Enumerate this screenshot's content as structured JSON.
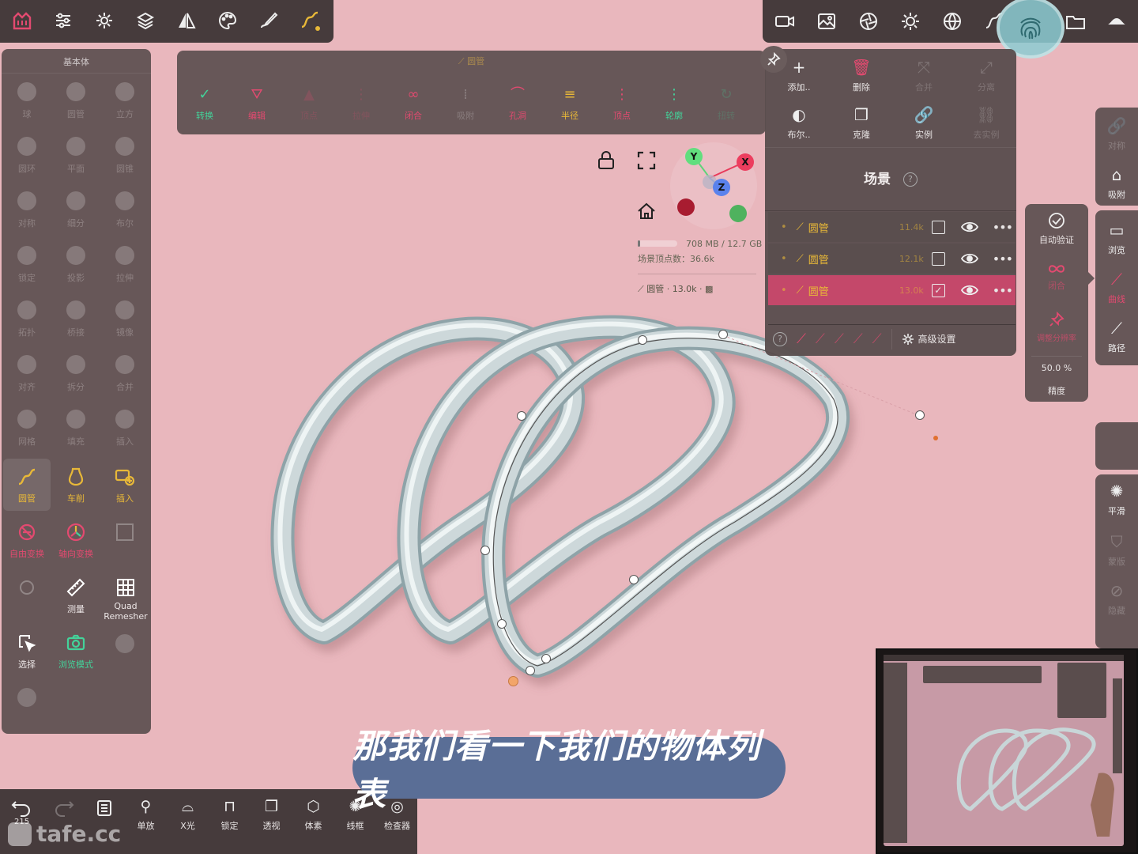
{
  "top_left_toolbar": {
    "icons": [
      "app-logo-icon",
      "sliders-icon",
      "settings-icon",
      "layers-icon",
      "symmetry-icon",
      "palette-icon",
      "brush-icon",
      "curve-icon"
    ]
  },
  "primitives_panel": {
    "title": "基本体",
    "dim_labels": [
      "球",
      "圆管",
      "立方",
      "圆环",
      "平面",
      "圆锥",
      "对称",
      "细分",
      "布尔",
      "锁定",
      "投影",
      "拉伸",
      "拓扑",
      "桥接",
      "镜像",
      "对齐",
      "拆分",
      "合并",
      "网格",
      "填充",
      "插入"
    ],
    "tools": [
      {
        "label": "圆管",
        "color": "#e8b838"
      },
      {
        "label": "车削",
        "color": "#e8b838"
      },
      {
        "label": "插入",
        "color": "#e8b838"
      },
      {
        "label": "自由变换",
        "color": "#e34a70"
      },
      {
        "label": "轴向变换",
        "color": "#e34a70"
      },
      {
        "label": "测量",
        "color": "#ffffff"
      },
      {
        "label": "Quad Remesher",
        "color": "#ffffff"
      },
      {
        "label": "选择",
        "color": "#ffffff"
      },
      {
        "label": "浏览模式",
        "color": "#43d39a"
      }
    ]
  },
  "curve_toolbar": {
    "title": "圆管",
    "items": [
      {
        "label": "转换",
        "active": true,
        "color": "#43d39a"
      },
      {
        "label": "编辑",
        "active": true,
        "color": "#e34a70"
      },
      {
        "label": "顶点",
        "active": false,
        "color": "#e34a70"
      },
      {
        "label": "拉伸",
        "active": false,
        "color": "#e34a70"
      },
      {
        "label": "闭合",
        "active": true,
        "color": "#e34a70"
      },
      {
        "label": "吸附",
        "active": false,
        "color": "#ffffff"
      },
      {
        "label": "孔洞",
        "active": true,
        "color": "#e34a70"
      },
      {
        "label": "半径",
        "active": true,
        "color": "#e8b838"
      },
      {
        "label": "顶点",
        "active": true,
        "color": "#e34a70"
      },
      {
        "label": "轮廓",
        "active": true,
        "color": "#43d39a"
      },
      {
        "label": "扭转",
        "active": false,
        "color": "#43d39a"
      }
    ]
  },
  "viewport": {
    "gizmo": {
      "x": "X",
      "y": "Y",
      "z": "Z"
    },
    "memory": "708 MB / 12.7 GB",
    "vertices": "场景顶点数：36.6k",
    "selection_info": "圆管 · 13.0k ·"
  },
  "top_right_toolbar": {
    "icons": [
      "camera-icon",
      "image-icon",
      "aperture-icon",
      "sun-icon",
      "globe-icon",
      "curve-icon",
      "fingerprint-icon",
      "folder-icon",
      "hat-icon"
    ]
  },
  "scene_panel": {
    "actions": [
      {
        "label": "添加..",
        "active": true
      },
      {
        "label": "删除",
        "active": true
      },
      {
        "label": "合并",
        "active": false
      },
      {
        "label": "分离",
        "active": false
      },
      {
        "label": "布尔..",
        "active": true
      },
      {
        "label": "克隆",
        "active": true
      },
      {
        "label": "实例",
        "active": true
      },
      {
        "label": "去实例",
        "active": false
      }
    ],
    "title": "场景",
    "objects": [
      {
        "name": "圆管",
        "count": "11.4k",
        "checked": false,
        "selected": false
      },
      {
        "name": "圆管",
        "count": "12.1k",
        "checked": false,
        "selected": false
      },
      {
        "name": "圆管",
        "count": "13.0k",
        "checked": true,
        "selected": true
      }
    ],
    "advanced": "高级设置"
  },
  "curve_side_panel": {
    "auto_validate": "自动验证",
    "close": "闭合",
    "subdivide": "调整分辨率",
    "percent": "50.0 %",
    "precision": "精度"
  },
  "right_strip": {
    "items": [
      {
        "label": "对称",
        "active": false
      },
      {
        "label": "吸附",
        "active": true
      },
      {
        "label": "浏览",
        "active": true
      },
      {
        "label": "曲线",
        "active": true,
        "color": "#e34a70"
      },
      {
        "label": "路径",
        "active": true
      },
      {
        "label": "平滑",
        "active": true
      },
      {
        "label": "蒙版",
        "active": false
      },
      {
        "label": "隐藏",
        "active": false
      }
    ]
  },
  "bottom_toolbar": {
    "undo_count": "215",
    "items": [
      "单放",
      "X光",
      "锁定",
      "透视",
      "体素",
      "线框",
      "检查器"
    ]
  },
  "subtitle": "那我们看一下我们的物体列表",
  "watermark": "tafe.cc",
  "colors": {
    "background": "#e9b7bd",
    "panel": "#5c5050",
    "accent_red": "#e34a70",
    "accent_yellow": "#e8b838",
    "accent_green": "#43d39a",
    "tube": "#c6d2d4"
  }
}
